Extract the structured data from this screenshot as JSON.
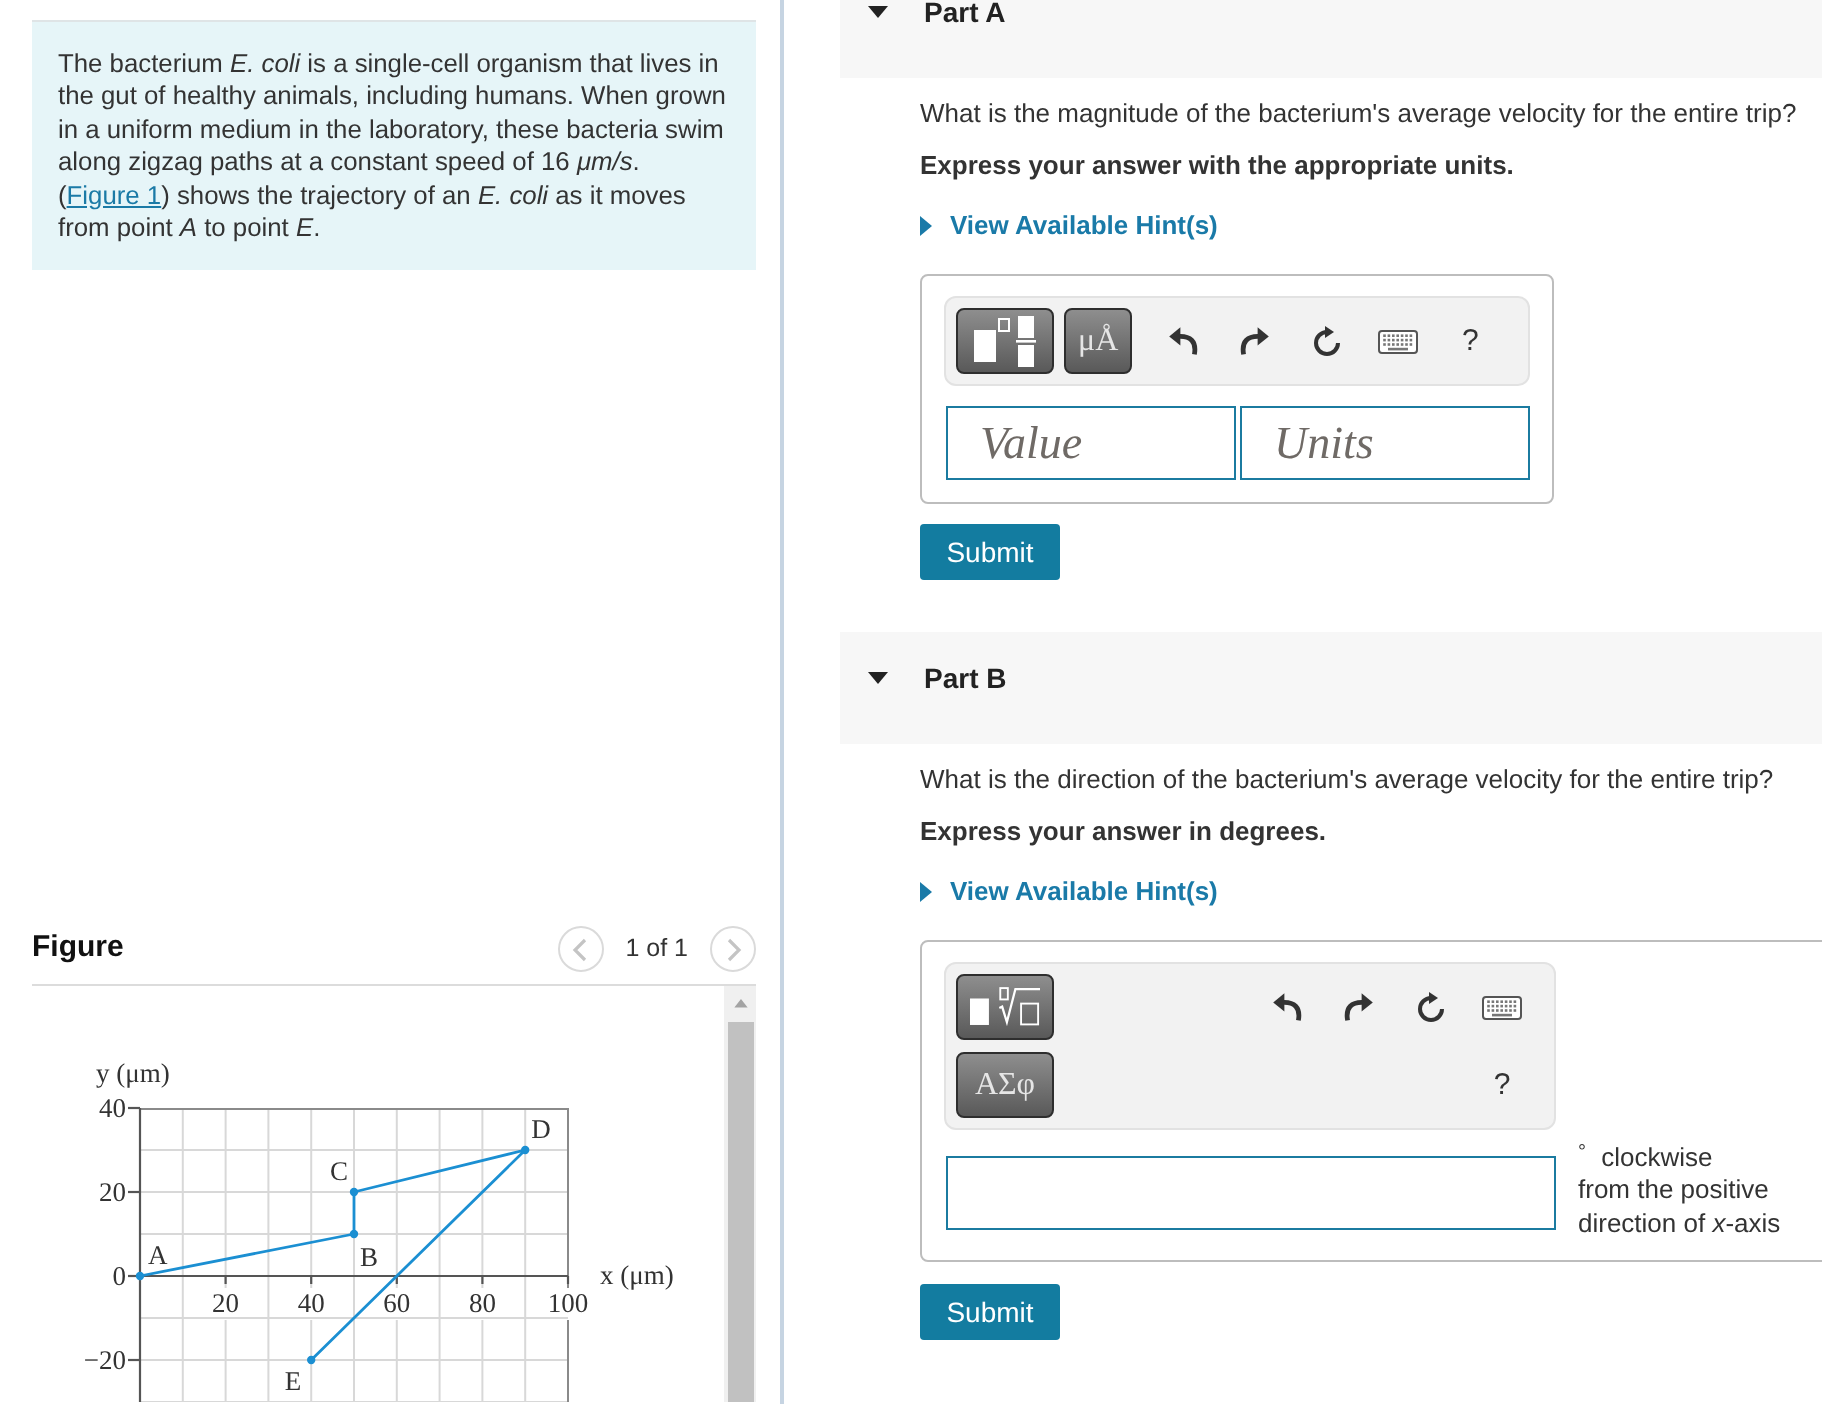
{
  "intro": {
    "text_before": "The bacterium *E. coli* is a single-cell organism that lives in the gut of healthy animals, including humans. When grown in a uniform medium in the laboratory, these bacteria swim along zigzag paths at a constant speed of 16 *μm/s*. (",
    "link": "Figure 1",
    "text_after": ") shows the trajectory of an *E. coli* as it moves from point *A* to point *E*."
  },
  "figure": {
    "title": "Figure",
    "pager": {
      "label": "1 of 1",
      "prev": {
        "disabled": true
      },
      "next": {
        "disabled": true
      }
    },
    "chart_data": {
      "type": "line",
      "xlabel": "x (μm)",
      "ylabel": "y (μm)",
      "x": [
        0,
        50,
        50,
        90,
        40
      ],
      "series": [
        {
          "color": "#1b8fd2",
          "marker": "circle",
          "values": [
            0,
            10,
            20,
            30,
            -20
          ]
        }
      ],
      "xlim": [
        0,
        100
      ],
      "ylim": [
        -30,
        40
      ],
      "xticks": [
        20,
        40,
        60,
        80,
        100
      ],
      "yticks": [
        {
          "value": -20,
          "label": "−20"
        },
        0,
        20,
        40
      ],
      "grid": true,
      "annotations": [
        {
          "x": 0,
          "y": 0,
          "text": "A"
        },
        {
          "x": 50,
          "y": 10,
          "text": "B"
        },
        {
          "x": 50,
          "y": 20,
          "text": "C"
        },
        {
          "x": 90,
          "y": 30,
          "text": "D"
        },
        {
          "x": 40,
          "y": -20,
          "text": "E"
        }
      ]
    }
  },
  "parts": [
    {
      "title": "Part A",
      "expanded": true,
      "question": "What is the magnitude of the bacterium's average velocity for the entire trip?",
      "instruction": "Express your answer with the appropriate units.",
      "hint": {
        "label": "View Available Hint(s)",
        "expanded": false
      },
      "toolbar": {
        "rows": [
          [
            {
              "kind": "template-fraction"
            },
            {
              "kind": "symbols",
              "label": "μÅ"
            },
            {
              "kind": "undo"
            },
            {
              "kind": "redo"
            },
            {
              "kind": "reset"
            },
            {
              "kind": "keyboard"
            },
            {
              "kind": "help",
              "label": "?"
            }
          ]
        ]
      },
      "fields": [
        {
          "kind": "text",
          "placeholder": "Value"
        },
        {
          "kind": "text",
          "placeholder": "Units"
        }
      ],
      "submit": "Submit"
    },
    {
      "title": "Part B",
      "expanded": true,
      "question": "What is the direction of the bacterium's average velocity for the entire trip?",
      "instruction": "Express your answer in degrees.",
      "hint": {
        "label": "View Available Hint(s)",
        "expanded": false
      },
      "toolbar": {
        "rows": [
          [
            {
              "kind": "template-root"
            },
            {
              "kind": "undo"
            },
            {
              "kind": "redo"
            },
            {
              "kind": "reset"
            },
            {
              "kind": "keyboard"
            }
          ],
          [
            {
              "kind": "symbols",
              "label": "ΑΣφ"
            },
            {
              "kind": "help",
              "label": "?"
            }
          ]
        ]
      },
      "fields": [
        {
          "kind": "text"
        }
      ],
      "unit_label": "$^{°}$ clockwise",
      "unit_description": "from the positive direction of *x*-axis",
      "submit": "Submit"
    }
  ]
}
